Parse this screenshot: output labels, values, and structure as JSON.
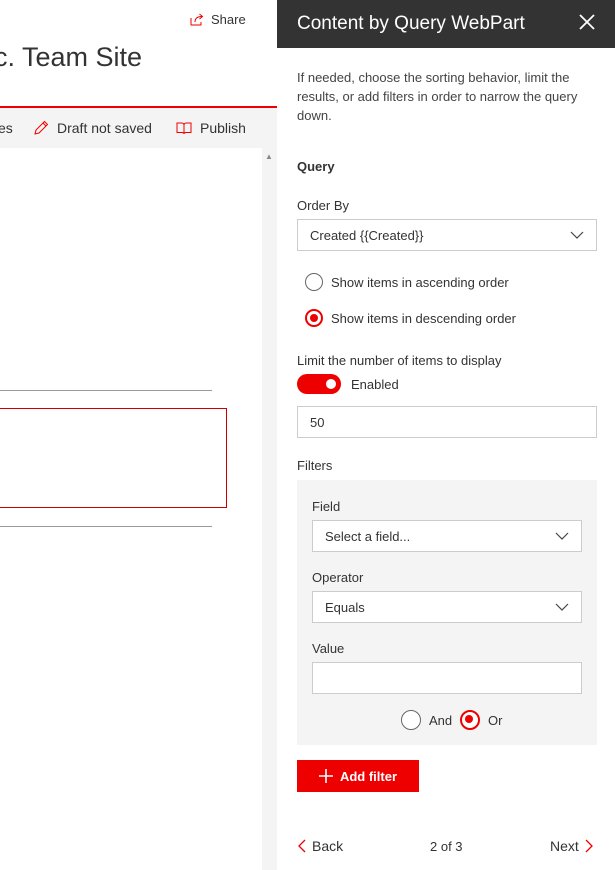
{
  "page": {
    "share_label": "Share",
    "site_title": "c. Team Site",
    "cmdbar": {
      "partial_label": "es",
      "draft_label": "Draft not saved",
      "publish_label": "Publish"
    }
  },
  "panel": {
    "title": "Content by Query WebPart",
    "description": "If needed, choose the sorting behavior, limit the results, or add filters in order to narrow the query down.",
    "query_heading": "Query",
    "order_by": {
      "label": "Order By",
      "value": "Created {{Created}}"
    },
    "sort_options": [
      {
        "label": "Show items in ascending order",
        "checked": false
      },
      {
        "label": "Show items in descending order",
        "checked": true
      }
    ],
    "limit": {
      "label": "Limit the number of items to display",
      "toggle_label": "Enabled",
      "enabled": true,
      "value": "50"
    },
    "filters": {
      "heading": "Filters",
      "field_label": "Field",
      "field_value": "Select a field...",
      "operator_label": "Operator",
      "operator_value": "Equals",
      "value_label": "Value",
      "value_value": "",
      "and_label": "And",
      "or_label": "Or",
      "selected": "Or"
    },
    "add_filter_label": "Add filter",
    "footer": {
      "back_label": "Back",
      "pager": "2 of 3",
      "next_label": "Next"
    }
  },
  "colors": {
    "accent": "#e00000",
    "header_bg": "#333333",
    "filter_bg": "#f4f4f4"
  }
}
